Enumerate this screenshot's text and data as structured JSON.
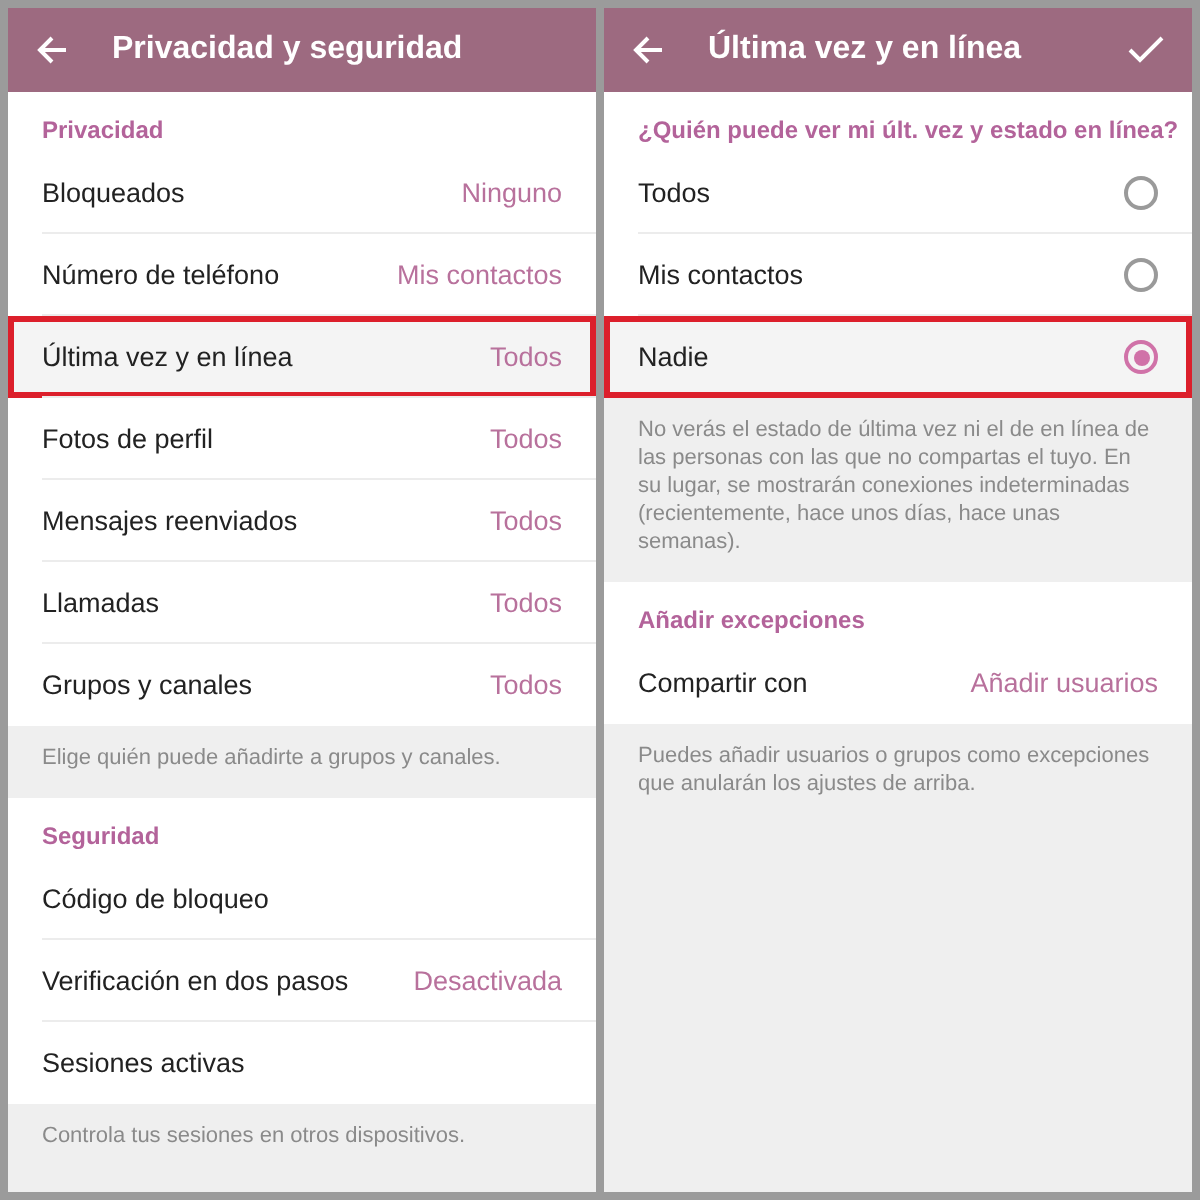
{
  "panels": [
    {
      "title": "Privacidad y seguridad",
      "confirm": false,
      "sections": [
        {
          "header": "Privacidad",
          "rows": [
            {
              "kind": "value",
              "label": "Bloqueados",
              "value": "Ninguno",
              "highlighted": false
            },
            {
              "kind": "value",
              "label": "Número de teléfono",
              "value": "Mis contactos",
              "highlighted": false
            },
            {
              "kind": "value",
              "label": "Última vez y en línea",
              "value": "Todos",
              "highlighted": true
            },
            {
              "kind": "value",
              "label": "Fotos de perfil",
              "value": "Todos",
              "highlighted": false
            },
            {
              "kind": "value",
              "label": "Mensajes reenviados",
              "value": "Todos",
              "highlighted": false
            },
            {
              "kind": "value",
              "label": "Llamadas",
              "value": "Todos",
              "highlighted": false
            },
            {
              "kind": "value",
              "label": "Grupos y canales",
              "value": "Todos",
              "highlighted": false
            }
          ],
          "note": "Elige quién puede añadirte a grupos y canales."
        },
        {
          "header": "Seguridad",
          "rows": [
            {
              "kind": "value",
              "label": "Código de bloqueo",
              "highlighted": false
            },
            {
              "kind": "value",
              "label": "Verificación en dos pasos",
              "value": "Desactivada",
              "highlighted": false
            },
            {
              "kind": "value",
              "label": "Sesiones activas",
              "highlighted": false
            }
          ],
          "note": "Controla tus sesiones en otros dispositivos."
        }
      ]
    },
    {
      "title": "Última vez y en línea",
      "confirm": true,
      "sections": [
        {
          "header": "¿Quién puede ver mi últ. vez y estado en línea?",
          "rows": [
            {
              "kind": "radio",
              "label": "Todos",
              "selected": false,
              "highlighted": false
            },
            {
              "kind": "radio",
              "label": "Mis contactos",
              "selected": false,
              "highlighted": false
            },
            {
              "kind": "radio",
              "label": "Nadie",
              "selected": true,
              "highlighted": true
            }
          ],
          "note": "No verás el estado de última vez ni el de en línea de las personas con las que no compartas el tuyo. En su lugar, se mostrarán conexiones indeterminadas (recientemente, hace unos días, hace unas semanas)."
        },
        {
          "header": "Añadir excepciones",
          "rows": [
            {
              "kind": "value",
              "label": "Compartir con",
              "value": "Añadir usuarios",
              "highlighted": false
            }
          ],
          "note": "Puedes añadir usuarios o grupos como excepciones que anularán los ajustes de arriba."
        }
      ]
    }
  ]
}
